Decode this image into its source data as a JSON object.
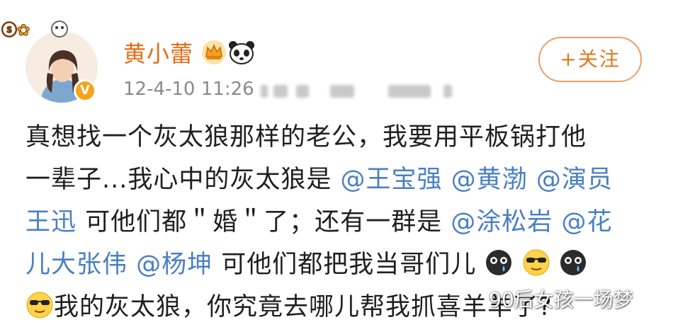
{
  "post": {
    "author": {
      "name": "黄小蕾",
      "badges": [
        "crown-icon",
        "panda-icon"
      ],
      "verified_icon": "verified-v-icon"
    },
    "timestamp": "12-4-10 11:26",
    "follow_label": "+关注",
    "content": {
      "line1": {
        "text": "真想找一个灰太狼那样的老公，我要用平板锅打他"
      },
      "line2": {
        "text": "一辈子...我心中的灰太狼是 ",
        "mention1": "@王宝强",
        "mention2": "@黄渤",
        "mention3": "@演员"
      },
      "line3": {
        "mention_cont": "王迅",
        "text": " 可他们都＂婚＂了；还有一群是 ",
        "mention1": "@涂松岩",
        "mention2": "@花"
      },
      "line4": {
        "mention_cont": "儿大张伟",
        "mention1": "@杨坤",
        "text": " 可他们都把我当哥们儿"
      },
      "line5": {
        "text": "我的灰太狼，你究竟去哪儿帮我抓喜羊羊了?"
      }
    },
    "emojis": [
      "crying-face-icon",
      "cool-face-icon",
      "crying-face-icon",
      "cool-face-icon"
    ]
  },
  "watermark": "90后女孩一场梦",
  "colors": {
    "username": "#e86b12",
    "mention": "#4a7fc4",
    "follow_border": "#e9a064"
  }
}
